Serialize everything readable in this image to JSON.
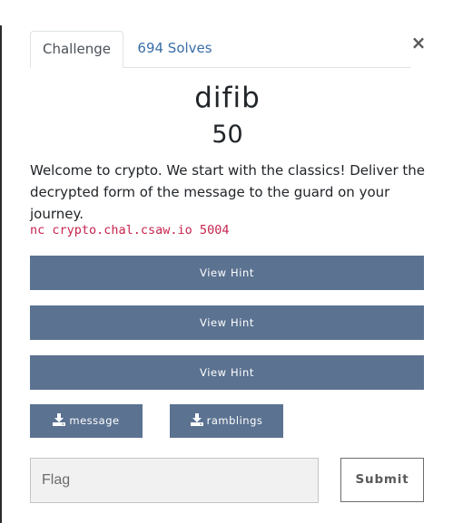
{
  "modal": {
    "close_label": "×",
    "tabs": [
      {
        "label": "Challenge"
      },
      {
        "label": "694 Solves"
      }
    ],
    "challenge": {
      "name": "difib",
      "value": "50",
      "description": "Welcome to crypto. We start with the classics! Deliver the decrypted form of the message to the guard on your journey.",
      "connection": "nc crypto.chal.csaw.io 5004"
    },
    "hints": [
      {
        "label": "View Hint"
      },
      {
        "label": "View Hint"
      },
      {
        "label": "View Hint"
      }
    ],
    "files": [
      {
        "label": "message",
        "icon": "download-icon"
      },
      {
        "label": "ramblings",
        "icon": "download-icon"
      }
    ],
    "submission": {
      "placeholder": "Flag",
      "value": "",
      "submit_label": "Submit"
    }
  },
  "colors": {
    "button_bg": "#5b7291",
    "tab_link": "#3a6ea8",
    "code_text": "#c7254e"
  }
}
